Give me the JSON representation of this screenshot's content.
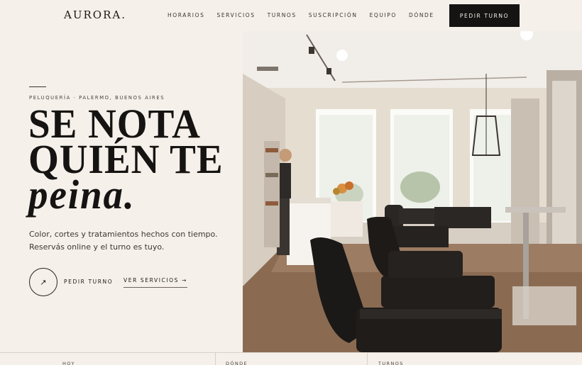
{
  "header": {
    "logo": "AURORA.",
    "nav": [
      "HORARIOS",
      "SERVICIOS",
      "TURNOS",
      "SUSCRIPCIÓN",
      "EQUIPO",
      "DÓNDE"
    ],
    "cta": "PEDIR TURNO"
  },
  "hero": {
    "eyebrow": "PELUQUERÍA · PALERMO, BUENOS AIRES",
    "headline_line1": "SE NOTA",
    "headline_line2": "QUIÉN TE",
    "headline_line3": "peina.",
    "subtext_line1": "Color, cortes y tratamientos hechos con tiempo.",
    "subtext_line2": "Reservás online y el turno es tuyo.",
    "circle_icon": "↗",
    "circle_label": "PEDIR TURNO",
    "secondary_link": "VER SERVICIOS →"
  },
  "bottom": {
    "cells": [
      "HOY",
      "DÓNDE",
      "TURNOS"
    ]
  },
  "colors": {
    "background": "#f5f0ea",
    "ink": "#161412",
    "accent_button": "#161412"
  }
}
